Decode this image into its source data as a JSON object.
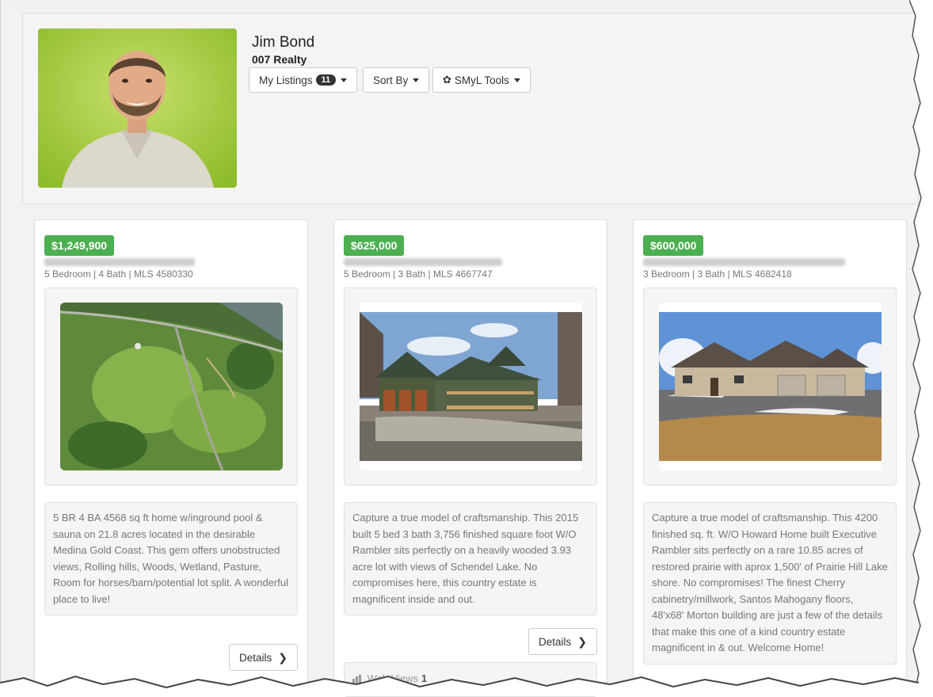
{
  "agent": {
    "name": "Jim Bond",
    "company": "007 Realty"
  },
  "toolbar": {
    "my_listings_label": "My Listings",
    "listing_count": "11",
    "sort_by_label": "Sort By",
    "tools_label": "SMyL Tools"
  },
  "listings": [
    {
      "price": "$1,249,900",
      "facts": "5 Bedroom | 4 Bath | MLS 4580330",
      "description": "5 BR 4 BA 4568 sq ft home w/inground pool & sauna on 21.8 acres located in the desirable Medina Gold Coast. This gem offers unobstructed views, Rolling hills, Woods, Wetland, Pasture, Room for horses/barn/potential lot split. A wonderful place to live!",
      "details_label": "Details"
    },
    {
      "price": "$625,000",
      "facts": "5 Bedroom | 3 Bath | MLS 4667747",
      "description": "Capture a true model of craftsmanship. This 2015 built 5 bed 3 bath 3,756 finished square foot W/O Rambler sits perfectly on a heavily wooded 3.93 acre lot with views of Schendel Lake. No compromises here, this country estate is magnificent inside and out.",
      "details_label": "Details",
      "web_views_label": "Web Views",
      "web_views_count": "1"
    },
    {
      "price": "$600,000",
      "facts": "3 Bedroom | 3 Bath | MLS 4682418",
      "description": "Capture a true model of craftsmanship. This 4200 finished sq. ft. W/O Howard Home built Executive Rambler sits perfectly on a rare 10.85 acres of restored prairie with aprox 1,500' of Prairie Hill Lake shore. No compromises! The finest Cherry cabinetry/millwork, Santos Mahogany floors, 48'x68' Morton building are just a few of the details that make this one of a kind country estate magnificent in & out. Welcome Home!"
    }
  ],
  "colors": {
    "price_badge": "#4caf50",
    "page_background": "#f1f2f4"
  },
  "icons": [
    "gear-icon",
    "caret-down-icon",
    "chevron-right-icon",
    "bar-chart-icon"
  ]
}
